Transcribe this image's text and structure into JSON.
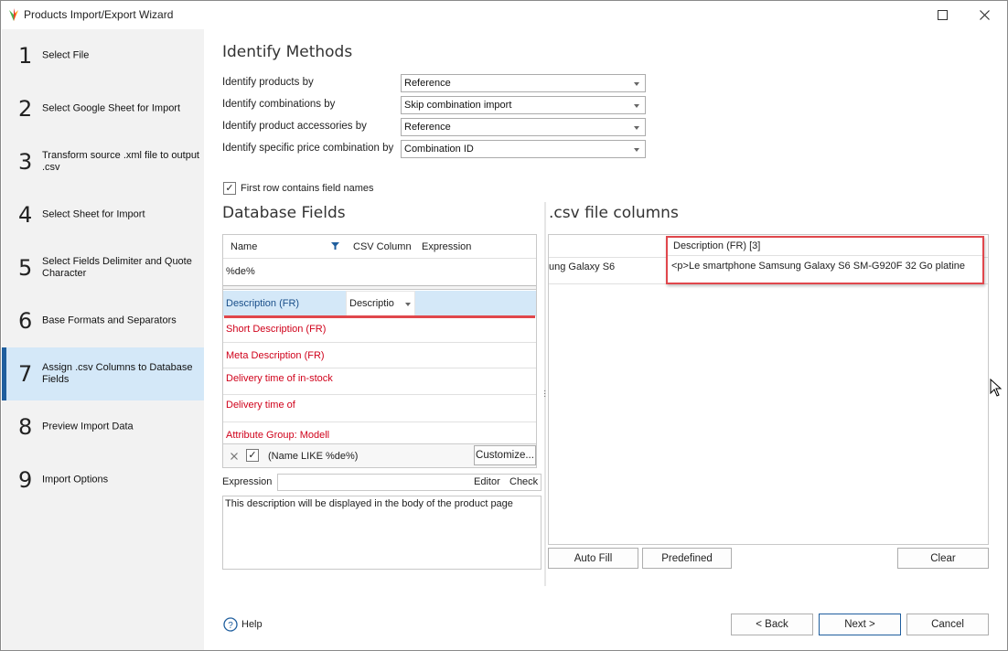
{
  "window": {
    "title": "Products Import/Export Wizard"
  },
  "steps": [
    {
      "num": "1",
      "label": "Select File"
    },
    {
      "num": "2",
      "label": "Select Google Sheet for Import"
    },
    {
      "num": "3",
      "label": "Transform source .xml file to output .csv"
    },
    {
      "num": "4",
      "label": "Select Sheet for Import"
    },
    {
      "num": "5",
      "label": "Select Fields Delimiter and Quote Character"
    },
    {
      "num": "6",
      "label": "Base Formats and Separators"
    },
    {
      "num": "7",
      "label": "Assign .csv Columns to Database Fields"
    },
    {
      "num": "8",
      "label": "Preview Import Data"
    },
    {
      "num": "9",
      "label": "Import Options"
    }
  ],
  "identify": {
    "heading": "Identify Methods",
    "rows": [
      {
        "label": "Identify products by",
        "value": "Reference"
      },
      {
        "label": "Identify combinations by",
        "value": "Skip combination import"
      },
      {
        "label": "Identify product accessories by",
        "value": "Reference"
      },
      {
        "label": "Identify specific price combination by",
        "value": "Combination ID"
      }
    ]
  },
  "first_row": {
    "label": "First row contains field names",
    "checked": true
  },
  "db_fields": {
    "heading": "Database Fields",
    "columns": {
      "name": "Name",
      "csv": "CSV Column",
      "expr": "Expression"
    },
    "filter_value": "%de%",
    "rows": [
      {
        "name": "Description (FR)",
        "csv": "Descriptio",
        "selected": true
      },
      {
        "name": "Short Description (FR)",
        "csv": ""
      },
      {
        "name": "Meta Description (FR)",
        "csv": ""
      },
      {
        "name": "Delivery time of in-stock",
        "csv": ""
      },
      {
        "name": "Delivery time of",
        "csv": ""
      },
      {
        "name": "Attribute Group: Modell",
        "csv": ""
      }
    ],
    "filter_text": "(Name LIKE %de%)",
    "customize_label": "Customize...",
    "expression_label": "Expression",
    "editor_label": "Editor",
    "check_label": "Check",
    "description_text": "This description will be displayed in the body of the product page"
  },
  "csv_cols": {
    "heading": ".csv file columns",
    "header": "Description (FR) [3]",
    "left_value": "ung Galaxy S6",
    "value": "<p>Le smartphone Samsung Galaxy S6 SM-G920F 32 Go platine",
    "auto_fill": "Auto Fill",
    "predefined": "Predefined",
    "clear": "Clear"
  },
  "footer": {
    "help": "Help",
    "back": "< Back",
    "next": "Next >",
    "cancel": "Cancel"
  },
  "colors": {
    "accent": "#1f5e9e",
    "highlight": "#e0474c",
    "field_red": "#d0021b",
    "selected_row": "#d4e8f8"
  }
}
